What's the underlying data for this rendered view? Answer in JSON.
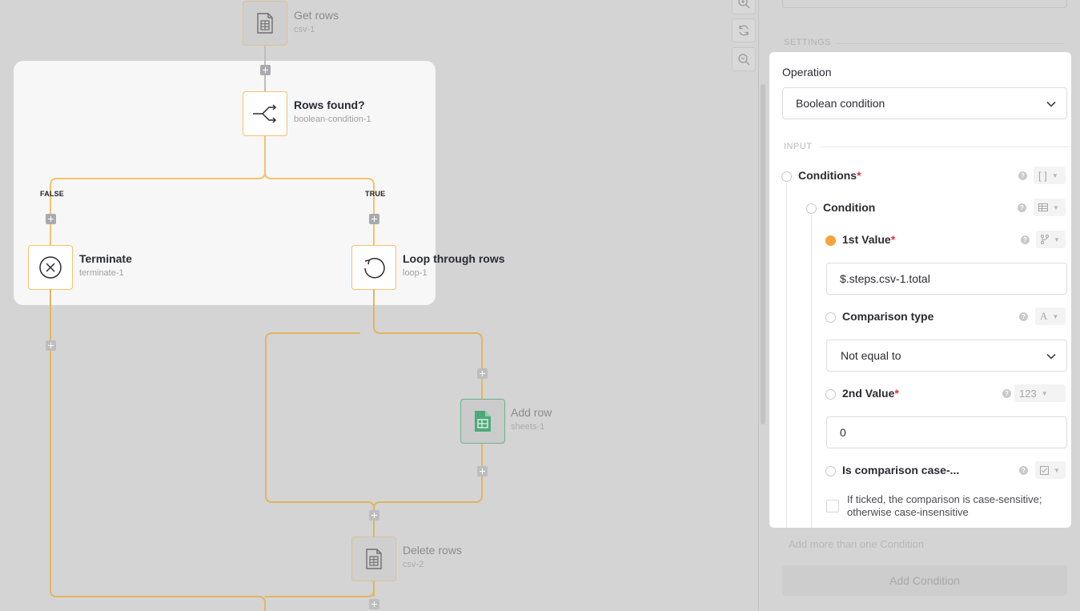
{
  "workflow": {
    "nodes": {
      "get_rows": {
        "title": "Get rows",
        "id": "csv-1",
        "icon": "spreadsheet-icon"
      },
      "rows_found": {
        "title": "Rows found?",
        "id": "boolean-condition-1",
        "icon": "branch-split-icon"
      },
      "terminate": {
        "title": "Terminate",
        "id": "terminate-1",
        "icon": "close-circle-icon"
      },
      "loop": {
        "title": "Loop through rows",
        "id": "loop-1",
        "icon": "loop-icon"
      },
      "add_row": {
        "title": "Add row",
        "id": "sheets-1",
        "icon": "google-sheets-icon"
      },
      "delete_rows": {
        "title": "Delete rows",
        "id": "csv-2",
        "icon": "spreadsheet-icon"
      }
    },
    "branches": {
      "false_label": "FALSE",
      "true_label": "TRUE"
    },
    "colors": {
      "connector": "#f5c26b",
      "highlight_bg": "#f7f7f7",
      "canvas_bg": "#d4d4d4"
    }
  },
  "zoom_controls": [
    "zoom-in-icon",
    "reset-zoom-icon",
    "zoom-out-icon"
  ],
  "panel": {
    "settings_section": "SETTINGS",
    "add_more_hint": "Add more than one Condition",
    "add_condition_button": "Add Condition",
    "operation": {
      "label": "Operation",
      "value": "Boolean condition"
    },
    "input_section": "INPUT",
    "conditions": {
      "label": "Conditions",
      "required": "*",
      "type_icon": "array-bracket-icon",
      "condition": {
        "label": "Condition",
        "type_icon": "table-icon",
        "first_value": {
          "label": "1st Value",
          "required": "*",
          "value": "$.steps.csv-1.total",
          "type_icon": "git-branch-icon"
        },
        "comparison_type": {
          "label": "Comparison type",
          "value": "Not equal to",
          "type_icon": "text-A-icon",
          "type_text": "A"
        },
        "second_value": {
          "label": "2nd Value",
          "required": "*",
          "value": "0",
          "type_text": "123"
        },
        "case_sensitive": {
          "label": "Is comparison case-...",
          "hint": "If ticked, the comparison is case-sensitive; otherwise case-insensitive",
          "checked": false,
          "type_icon": "checkbox-icon"
        }
      }
    },
    "accent_color": "#f7a23b",
    "required_color": "#e0303c"
  }
}
